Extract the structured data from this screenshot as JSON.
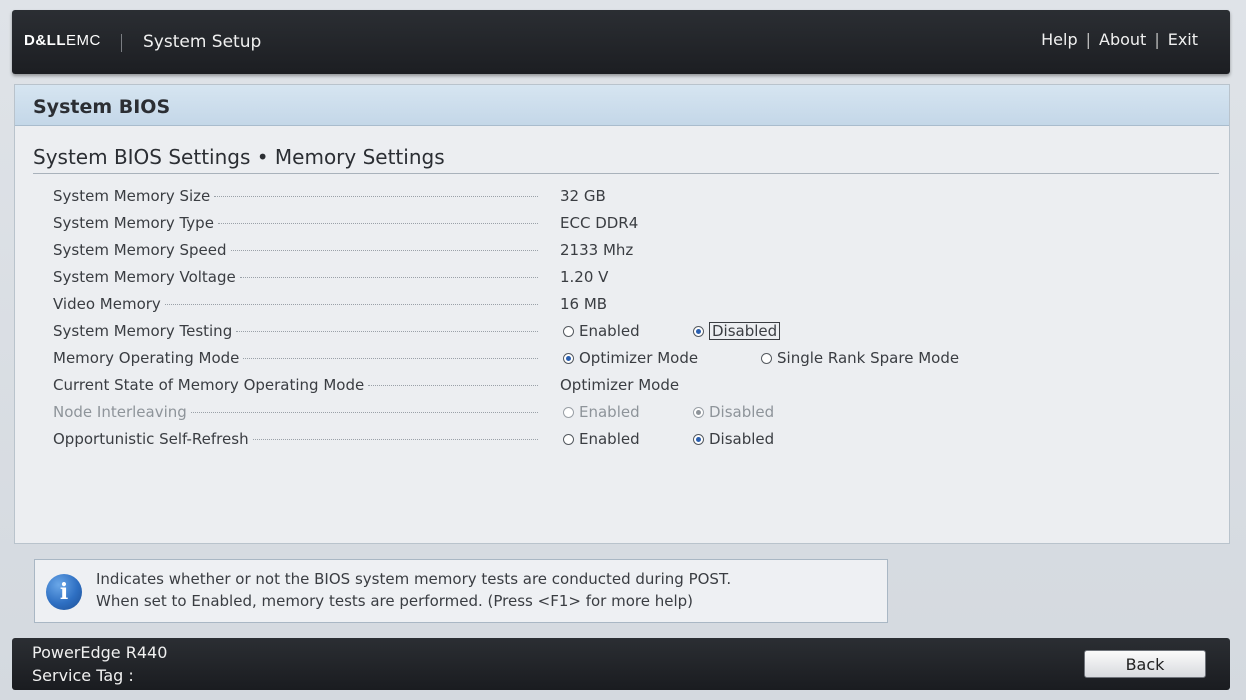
{
  "header": {
    "logo_dell": "D&LL",
    "logo_emc": "EMC",
    "app_title": "System Setup",
    "links": [
      "Help",
      "About",
      "Exit"
    ],
    "separator": "|"
  },
  "panel": {
    "title": "System BIOS",
    "breadcrumb": "System BIOS Settings • Memory Settings"
  },
  "settings": [
    {
      "label": "System Memory Size",
      "value": "32 GB"
    },
    {
      "label": "System Memory Type",
      "value": "ECC DDR4"
    },
    {
      "label": "System Memory Speed",
      "value": "2133 Mhz"
    },
    {
      "label": "System Memory Voltage",
      "value": "1.20 V"
    },
    {
      "label": "Video Memory",
      "value": "16 MB"
    },
    {
      "label": "System Memory Testing",
      "options": [
        "Enabled",
        "Disabled"
      ],
      "selected": "Disabled"
    },
    {
      "label": "Memory Operating Mode",
      "options": [
        "Optimizer Mode",
        "Single Rank Spare Mode"
      ],
      "selected": "Optimizer Mode"
    },
    {
      "label": "Current State of Memory Operating Mode",
      "value": "Optimizer Mode"
    },
    {
      "label": "Node Interleaving",
      "options": [
        "Enabled",
        "Disabled"
      ],
      "selected": "Disabled",
      "disabled": true
    },
    {
      "label": "Opportunistic Self-Refresh",
      "options": [
        "Enabled",
        "Disabled"
      ],
      "selected": "Disabled"
    }
  ],
  "help": {
    "icon": "info-icon",
    "line1": "Indicates whether or not the BIOS system memory tests are conducted during POST.",
    "line2": "When set to Enabled, memory tests are performed. (Press <F1> for more help)"
  },
  "footer": {
    "model": "PowerEdge R440",
    "service_tag_label": "Service Tag :",
    "back_label": "Back"
  },
  "colors": {
    "header_bg": "#1f2125",
    "title_bar": "#c9dbea",
    "panel_bg": "#eceef1",
    "radio_dot": "#2a5fb0",
    "info_icon": "#2e6fc2"
  }
}
